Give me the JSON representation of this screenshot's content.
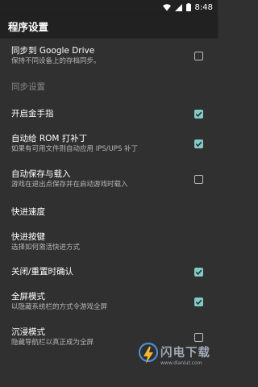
{
  "status_bar": {
    "time": "8:48",
    "icons": [
      "wifi-icon",
      "signal-icon",
      "battery-icon"
    ]
  },
  "app_bar": {
    "title": "程序设置"
  },
  "preferences": [
    {
      "title": "同步到 Google Drive",
      "summary": "保持不同设备上的存档同步。",
      "checkbox": "unchecked"
    },
    {
      "title": "同步设置",
      "disabled": true
    },
    {
      "title": "开启金手指",
      "checkbox": "checked"
    },
    {
      "title": "自动给 ROM 打补丁",
      "summary": "如果有可用文件则自动应用 IPS/UPS 补丁",
      "checkbox": "checked"
    },
    {
      "title": "自动保存与载入",
      "summary": "游戏在退出点保存并在启动游戏时载入",
      "checkbox": "unchecked"
    },
    {
      "title": "快进速度"
    },
    {
      "title": "快进按键",
      "summary": "选择如何激活快进方式"
    },
    {
      "title": "关闭/重置时确认",
      "checkbox": "checked"
    },
    {
      "title": "全屏模式",
      "summary": "以隐藏系统栏的方式令游戏全屏",
      "checkbox": "checked"
    },
    {
      "title": "沉浸模式",
      "summary": "隐藏导航栏以真正成为全屏",
      "checkbox": "unchecked"
    }
  ],
  "watermark": {
    "main": "闪电下载",
    "url": "www.dianlut.com"
  },
  "colors": {
    "background": "#303030",
    "bar": "#212121",
    "accent": "#80cbc4"
  }
}
